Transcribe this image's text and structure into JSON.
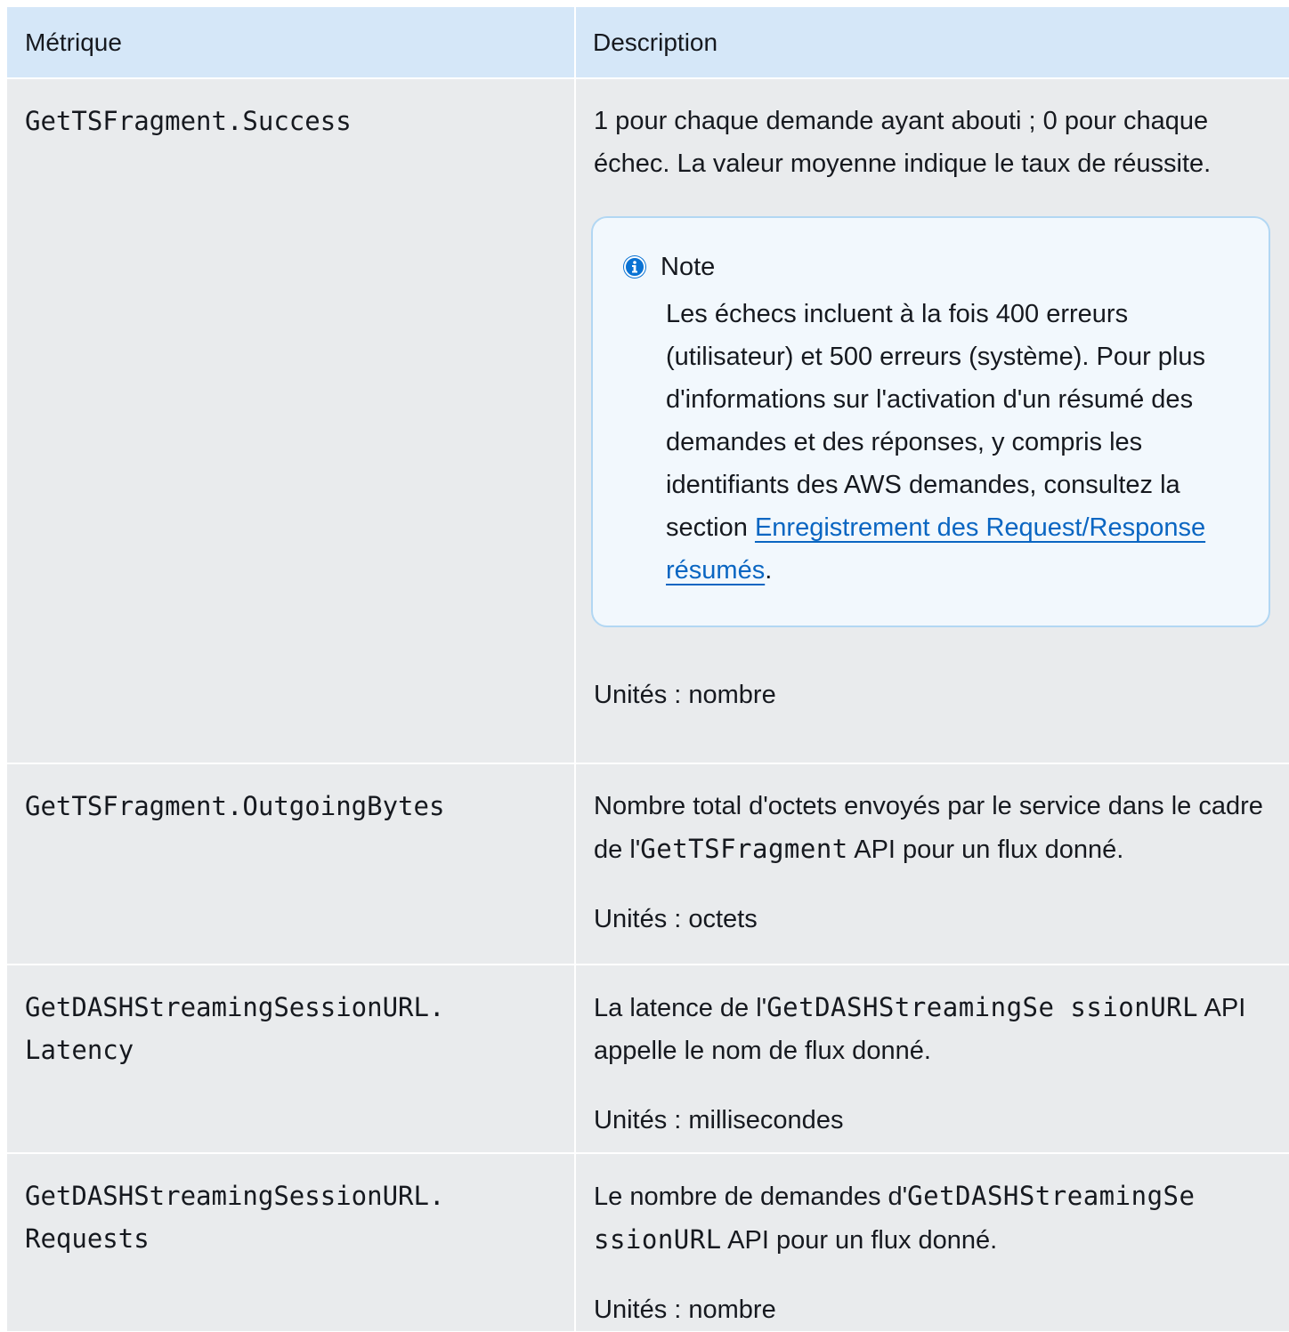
{
  "table": {
    "headers": {
      "metric": "Métrique",
      "description": "Description"
    },
    "rows": [
      {
        "metric": "GetTSFragment.Success",
        "desc_text": "1 pour chaque demande ayant abouti ; 0 pour chaque échec. La valeur moyenne indique le taux de réussite.",
        "note": {
          "title": "Note",
          "text_before_link": "Les échecs incluent à la fois 400 erreurs (utilisateur) et 500 erreurs (système). Pour plus d'informations sur l'activation d'un résumé des demandes et des réponses, y compris les identifiants des AWS demandes, consultez la section ",
          "link_text": "Enregistrement des Request/Response résumés",
          "text_after_link": "."
        },
        "units": "Unités : nombre"
      },
      {
        "metric": "GetTSFragment.OutgoingBytes",
        "desc_before_code": "Nombre total d'octets envoyés par le service dans le cadre de l'",
        "desc_code": "GetTSFragment",
        "desc_after_code": " API pour un flux donné.",
        "units": "Unités : octets"
      },
      {
        "metric": "GetDASHStreamingSessionURL.\nLatency",
        "desc_before_code": "La latence de l'",
        "desc_code": "GetDASHStreamingSe ssionURL",
        "desc_after_code": " API appelle le nom de flux donné.",
        "units": "Unités : millisecondes"
      },
      {
        "metric": "GetDASHStreamingSessionURL.\nRequests",
        "desc_before_code": "Le nombre de demandes d'",
        "desc_code": "GetDASHStreamingSe ssionURL",
        "desc_after_code": " API pour un flux donné.",
        "units": "Unités : nombre"
      }
    ]
  },
  "icons": {
    "note_icon": "info-circle-icon",
    "note_icon_color": "#0972d3"
  },
  "colors": {
    "header_bg": "#d5e7f8",
    "row_bg": "#e9ebed",
    "note_bg": "#f2f8fd",
    "note_border": "#b2d7f3",
    "link": "#0a66c2"
  }
}
